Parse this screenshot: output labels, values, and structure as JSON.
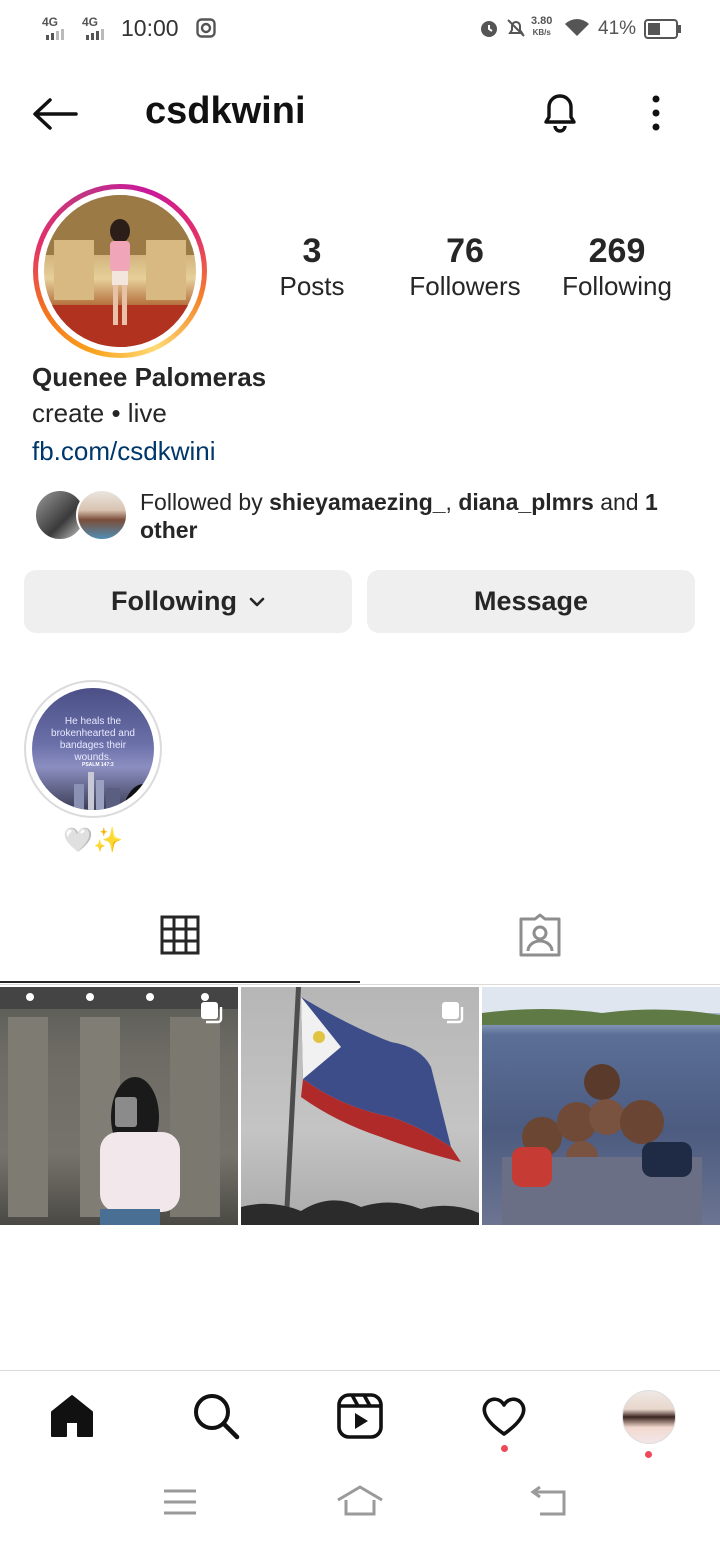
{
  "status_bar": {
    "network1": "4G",
    "network2": "4G",
    "time": "10:00",
    "speed_value": "3.80",
    "speed_unit": "KB/s",
    "battery": "41%"
  },
  "header": {
    "username": "csdkwini"
  },
  "profile": {
    "stats": [
      {
        "value": "3",
        "label": "Posts"
      },
      {
        "value": "76",
        "label": "Followers"
      },
      {
        "value": "269",
        "label": "Following"
      }
    ],
    "name": "Quenee Palomeras",
    "bio": "create • live",
    "link": "fb.com/csdkwini"
  },
  "mutual": {
    "prefix": "Followed by ",
    "user1": "shieyamaezing_",
    "sep": ", ",
    "user2": "diana_plmrs",
    "mid": " and ",
    "rest": "1 other"
  },
  "actions": {
    "following_label": "Following",
    "message_label": "Message"
  },
  "highlight": {
    "cover_text": "He heals the brokenhearted and bandages their wounds.",
    "cover_ref": "PSALM 147:3",
    "label": "🤍✨"
  },
  "icons": {
    "back": "arrow-left-icon",
    "bell": "bell-icon",
    "more": "more-vertical-icon",
    "grid": "grid-icon",
    "tagged": "tagged-icon",
    "home": "home-icon",
    "search": "search-icon",
    "reels": "reels-icon",
    "activity": "heart-icon"
  },
  "colors": {
    "link": "#00376b",
    "button_bg": "#efefef",
    "notification_dot": "#ed4956"
  }
}
